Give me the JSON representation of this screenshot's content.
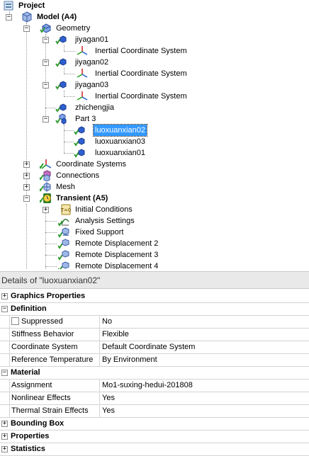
{
  "tree": {
    "project": "Project",
    "model": "Model (A4)",
    "geometry": "Geometry",
    "jiyagan01": "jiyagan01",
    "ics1": "Inertial Coordinate System",
    "jiyagan02": "jiyagan02",
    "ics2": "Inertial Coordinate System",
    "jiyagan03": "jiyagan03",
    "ics3": "Inertial Coordinate System",
    "zhichengjia": "zhichengjia",
    "part3": "Part 3",
    "luoxuanxian02": "luoxuanxian02",
    "luoxuanxian03": "luoxuanxian03",
    "luoxuanxian01": "luoxuanxian01",
    "coordinate_systems": "Coordinate Systems",
    "connections": "Connections",
    "mesh": "Mesh",
    "transient": "Transient (A5)",
    "initial_conditions": "Initial Conditions",
    "analysis_settings": "Analysis Settings",
    "fixed_support": "Fixed Support",
    "remote_disp2": "Remote Displacement 2",
    "remote_disp3": "Remote Displacement 3",
    "remote_disp4": "Remote Displacement 4"
  },
  "details": {
    "title": "Details of \"luoxuanxian02\"",
    "categories": {
      "graphics": "Graphics Properties",
      "definition": "Definition",
      "material": "Material",
      "bounding_box": "Bounding Box",
      "properties": "Properties",
      "statistics": "Statistics"
    },
    "definition": {
      "suppressed_label": "Suppressed",
      "suppressed_value": "No",
      "stiffness_label": "Stiffness Behavior",
      "stiffness_value": "Flexible",
      "coord_label": "Coordinate System",
      "coord_value": "Default Coordinate System",
      "reftemp_label": "Reference Temperature",
      "reftemp_value": "By Environment"
    },
    "material": {
      "assignment_label": "Assignment",
      "assignment_value": "Mo1-suxing-hedui-201808",
      "nonlinear_label": "Nonlinear Effects",
      "nonlinear_value": "Yes",
      "thermal_label": "Thermal Strain Effects",
      "thermal_value": "Yes"
    }
  },
  "colors": {
    "selection": "#3399ff",
    "check": "#2e9a2e",
    "body_icon": "#2f5fd0",
    "transient_icon": "#d4a800"
  }
}
